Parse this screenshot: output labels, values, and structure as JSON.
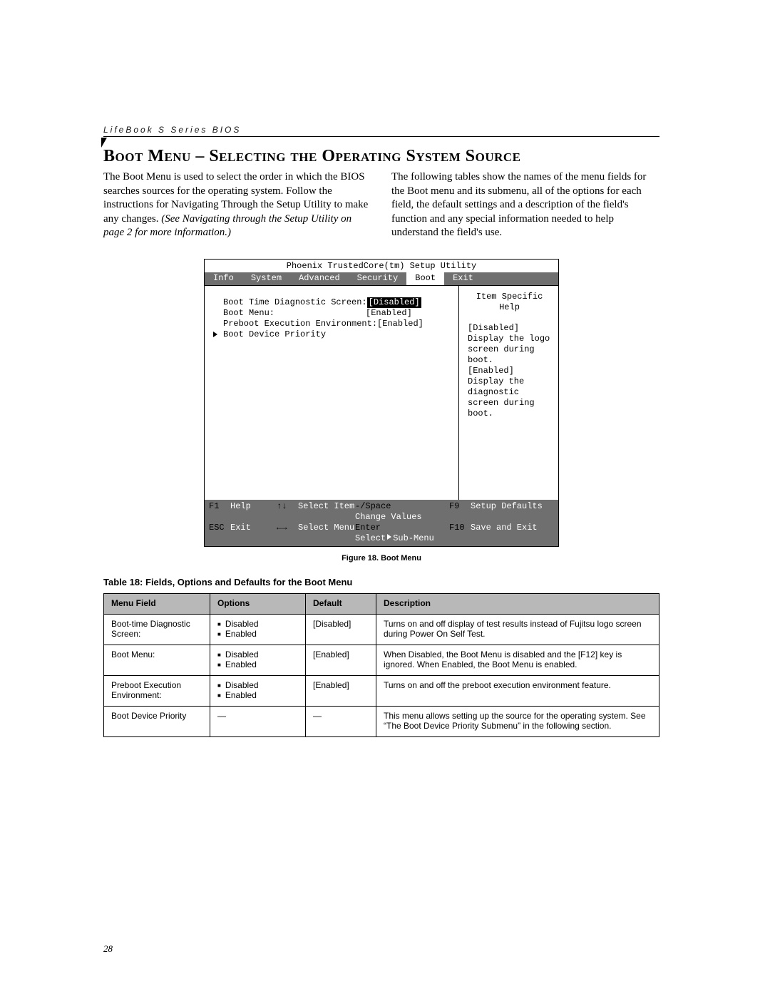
{
  "running_head": "LifeBook S Series BIOS",
  "page_number": "28",
  "section_title": "Boot Menu – Selecting the Operating System Source",
  "intro_left_plain": "The Boot Menu is used to select the order in which the BIOS searches sources for the operating system. Follow the instructions for Navigating Through the Setup Utility to make any changes. ",
  "intro_left_italic": "(See Navigating through the Setup Utility on page 2 for more information.)",
  "intro_right": "The following tables show the names of the menu fields for the Boot menu and its submenu, all of the options for each field, the default settings and a description of the field's function and any special information needed to help understand the field's use.",
  "bios": {
    "title": "Phoenix TrustedCore(tm) Setup Utility",
    "tabs": [
      "Info",
      "System",
      "Advanced",
      "Security",
      "Boot",
      "Exit"
    ],
    "active_tab": 4,
    "items": [
      {
        "label": "Boot Time Diagnostic Screen:",
        "value": "[Disabled]",
        "selected": true
      },
      {
        "label": "Boot Menu:",
        "value": "[Enabled]"
      },
      {
        "label": "Preboot Execution Environment:",
        "value": "[Enabled]"
      },
      {
        "label": "Boot Device Priority",
        "submenu": true
      }
    ],
    "help_title": "Item Specific Help",
    "help_body": [
      "[Disabled]",
      "Display the logo screen during boot.",
      "",
      "[Enabled]",
      "Display the diagnostic screen during boot."
    ],
    "footer": {
      "row1": {
        "k1": "F1",
        "a1": "Help",
        "k2": "↑↓",
        "a2": "Select Item",
        "k3": "-/Space",
        "a3": "Change Values",
        "k4": "F9",
        "a4": "Setup Defaults"
      },
      "row2": {
        "k1": "ESC",
        "a1": "Exit",
        "k2": "←→",
        "a2": "Select Menu",
        "k3": "Enter",
        "a3_pre": "Select ",
        "a3_post": " Sub-Menu",
        "k4": "F10",
        "a4": "Save and Exit"
      }
    }
  },
  "figure_caption": "Figure 18.  Boot Menu",
  "table_title": "Table 18: Fields, Options and Defaults for the Boot Menu",
  "table_headers": [
    "Menu Field",
    "Options",
    "Default",
    "Description"
  ],
  "table_rows": [
    {
      "menu": "Boot-time Diagnostic Screen:",
      "options": [
        "Disabled",
        "Enabled"
      ],
      "default": "[Disabled]",
      "desc": "Turns on and off display of test results instead of Fujitsu logo screen during Power On Self Test."
    },
    {
      "menu": "Boot Menu:",
      "options": [
        "Disabled",
        "Enabled"
      ],
      "default": "[Enabled]",
      "desc": "When Disabled, the Boot Menu is disabled and the [F12] key is ignored. When Enabled, the Boot Menu is enabled."
    },
    {
      "menu": "Preboot Execution Environment:",
      "options": [
        "Disabled",
        "Enabled"
      ],
      "default": "[Enabled]",
      "desc": "Turns on and off the preboot execution environment feature."
    },
    {
      "menu": "Boot Device Priority",
      "options": [],
      "default": "—",
      "desc": "This menu allows setting up the source for the operating system. See “The Boot Device Priority Submenu” in the following section."
    }
  ]
}
